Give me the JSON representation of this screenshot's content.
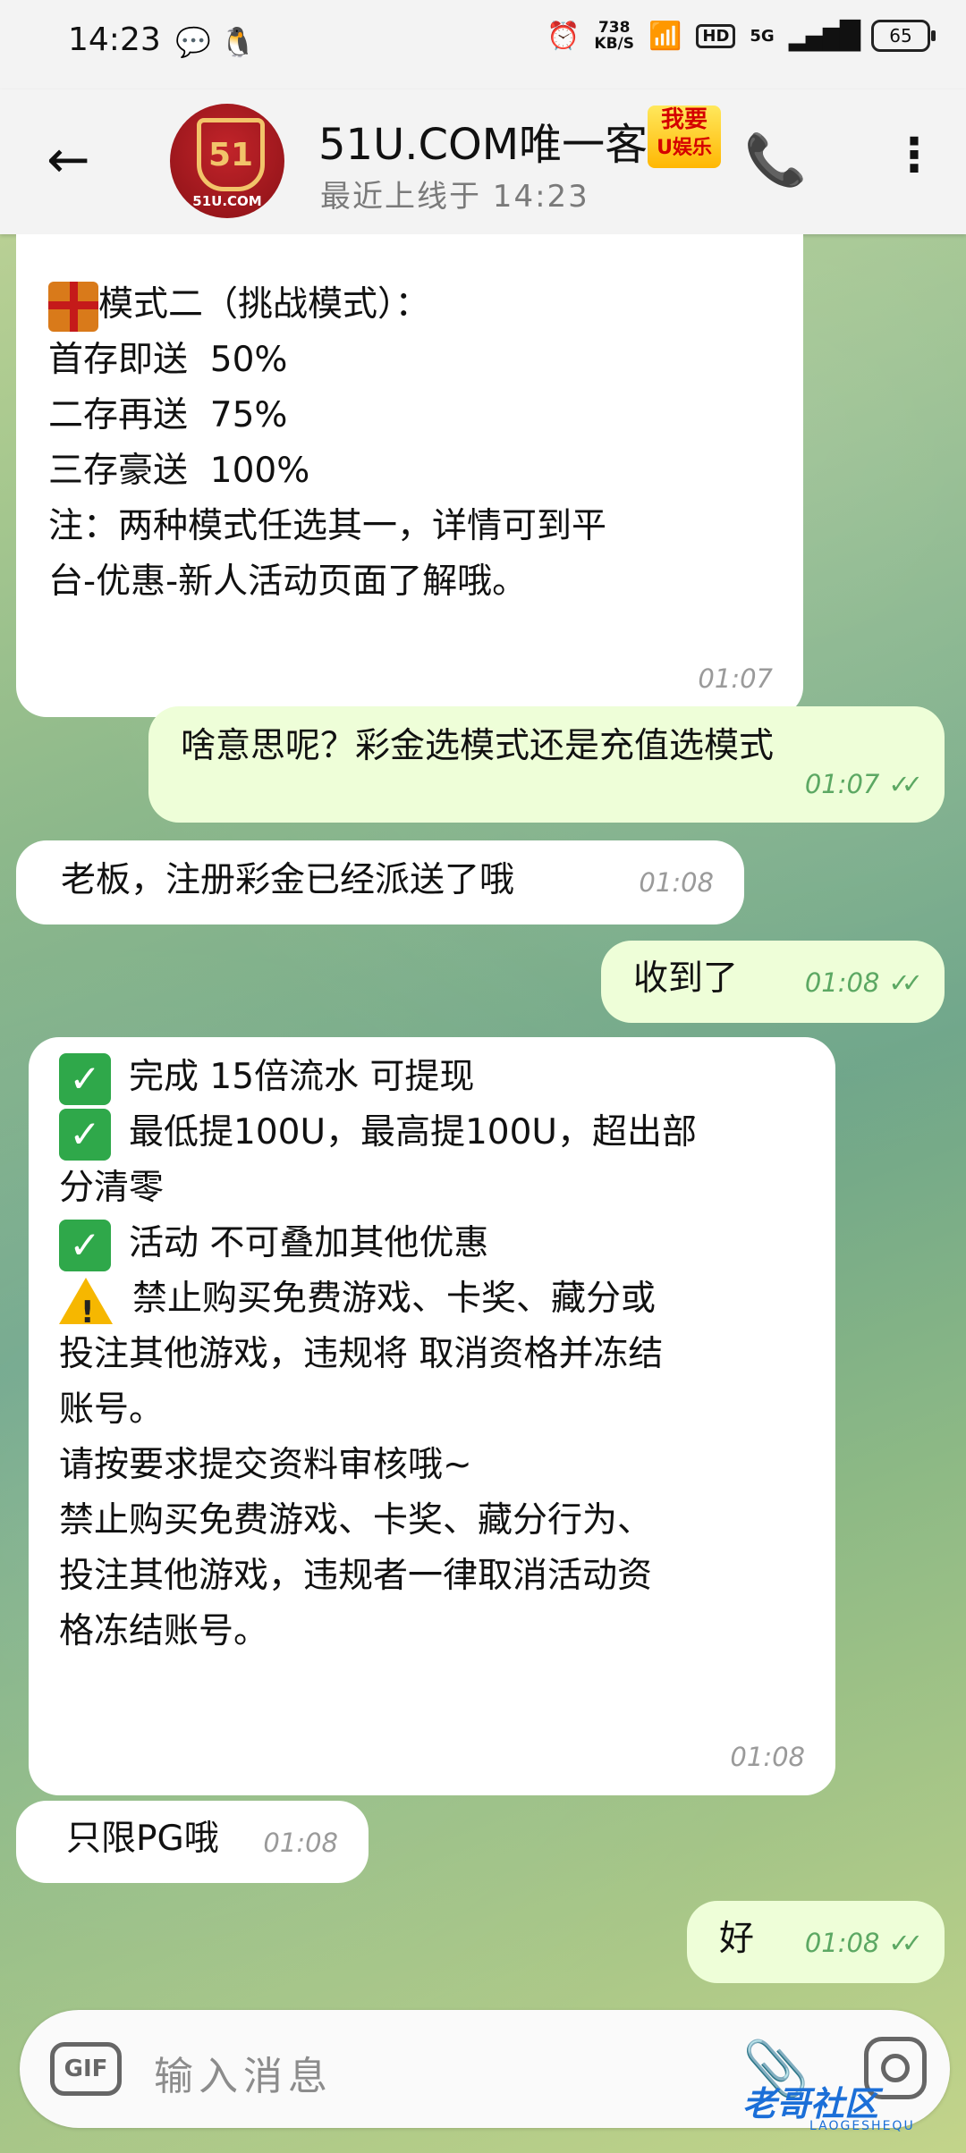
{
  "status_bar": {
    "time": "14:23",
    "speed_value": "738",
    "speed_unit": "KB/S",
    "hd": "HD",
    "signal": "5G",
    "battery": "65"
  },
  "header": {
    "title": "51U.COM唯一客",
    "last_seen": "最近上线于 14:23",
    "avatar_text": "51",
    "avatar_site": "51U.COM",
    "promo_line1": "我要",
    "promo_line2": "U娱乐"
  },
  "messages": [
    {
      "dir": "in",
      "lines": [
        "模式二（挑战模式）：",
        "首存即送  50%",
        "二存再送  75%",
        "三存豪送  100%",
        "",
        "注：两种模式任选其一，详情可到平",
        "台-优惠-新人活动页面了解哦。"
      ],
      "time": "01:07"
    },
    {
      "dir": "out",
      "text": "啥意思呢？彩金选模式还是充值选模式",
      "time": "01:07"
    },
    {
      "dir": "in",
      "text": "老板，注册彩金已经派送了哦",
      "time": "01:08"
    },
    {
      "dir": "out",
      "text": "收到了",
      "time": "01:08"
    },
    {
      "dir": "in",
      "lines": [
        "完成 15倍流水 可提现",
        "最低提100U，最高提100U，超出部",
        "分清零",
        "活动 不可叠加其他优惠",
        "",
        "禁止购买免费游戏、卡奖、藏分或",
        "投注其他游戏，违规将 取消资格并冻结",
        "账号。",
        "",
        "请按要求提交资料审核哦~",
        "禁止购买免费游戏、卡奖、藏分行为、",
        "投注其他游戏，违规者一律取消活动资",
        "格冻结账号。"
      ],
      "time": "01:08"
    },
    {
      "dir": "in",
      "text": "只限PG哦",
      "time": "01:08"
    },
    {
      "dir": "out",
      "text": "好",
      "time": "01:08"
    }
  ],
  "input": {
    "gif_label": "GIF",
    "placeholder": "输入消息"
  },
  "watermark": {
    "text": "老哥社区",
    "sub": "LAOGESHEQU"
  },
  "colors": {
    "incoming": "#ffffff",
    "outgoing": "#eefed8",
    "time_out": "#5ca863"
  }
}
